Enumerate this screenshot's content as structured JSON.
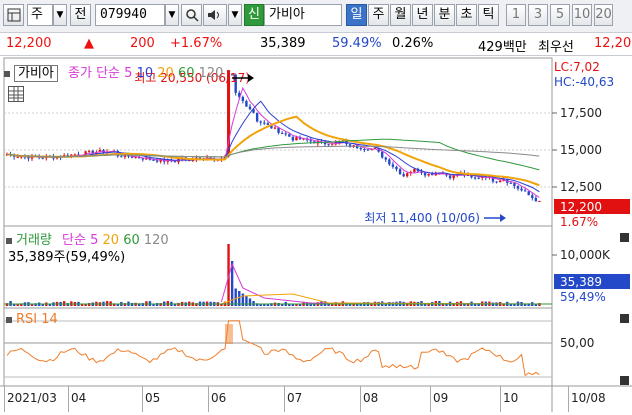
{
  "toolbar": {
    "layout_icon": "window-layout-icon",
    "market": "주",
    "code_label": "전",
    "code_value": "079940",
    "search_icon": "search-icon",
    "sound_icon": "speaker-icon",
    "new_badge": "신",
    "stock_name": "가비아",
    "periods": [
      "일",
      "주",
      "월",
      "년",
      "분",
      "초",
      "틱"
    ],
    "active_period": "일",
    "intervals": [
      "1",
      "3",
      "5",
      "10",
      "20"
    ]
  },
  "quote": {
    "price": "12,200",
    "change": "200",
    "change_pct": "+1.67%",
    "volume": "35,389",
    "vol_ratio": "59.49%",
    "turnover": "0.26%",
    "amount": "429백만",
    "best_ask_label": "최우선",
    "best_ask": "12,20"
  },
  "price_panel": {
    "name_tag": "가비아",
    "ma_label": "종가 단순",
    "ma_periods": [
      "5",
      "10",
      "20",
      "60",
      "120"
    ],
    "high_note": "최고 20,550 (06/17)",
    "low_note": "최저 11,400 (10/06)",
    "lc": "LC:7,02",
    "hc": "HC:-40,63",
    "y_ticks": [
      "17,500",
      "15,000",
      "12,500"
    ],
    "current_price": "12,200",
    "current_pct": "1.67%"
  },
  "volume_panel": {
    "title": "거래량",
    "ma_label": "단순",
    "ma_periods": [
      "5",
      "20",
      "60",
      "120"
    ],
    "summary": "35,389주(59,49%)",
    "y_tick": "10,000K",
    "current": "35,389",
    "current_pct": "59,49%"
  },
  "rsi_panel": {
    "title": "RSI 14",
    "y_tick": "50,00"
  },
  "x_axis": [
    "2021/03",
    "04",
    "05",
    "06",
    "07",
    "08",
    "09",
    "10",
    "10/08"
  ],
  "colors": {
    "up": "#e11111",
    "down": "#2348c8",
    "ma5": "#d63bd6",
    "ma10": "#2b3fd1",
    "ma20": "#f0a30a",
    "ma60": "#2e9a3a",
    "ma120": "#8a8a8a",
    "rsi": "#f07d2a"
  }
}
